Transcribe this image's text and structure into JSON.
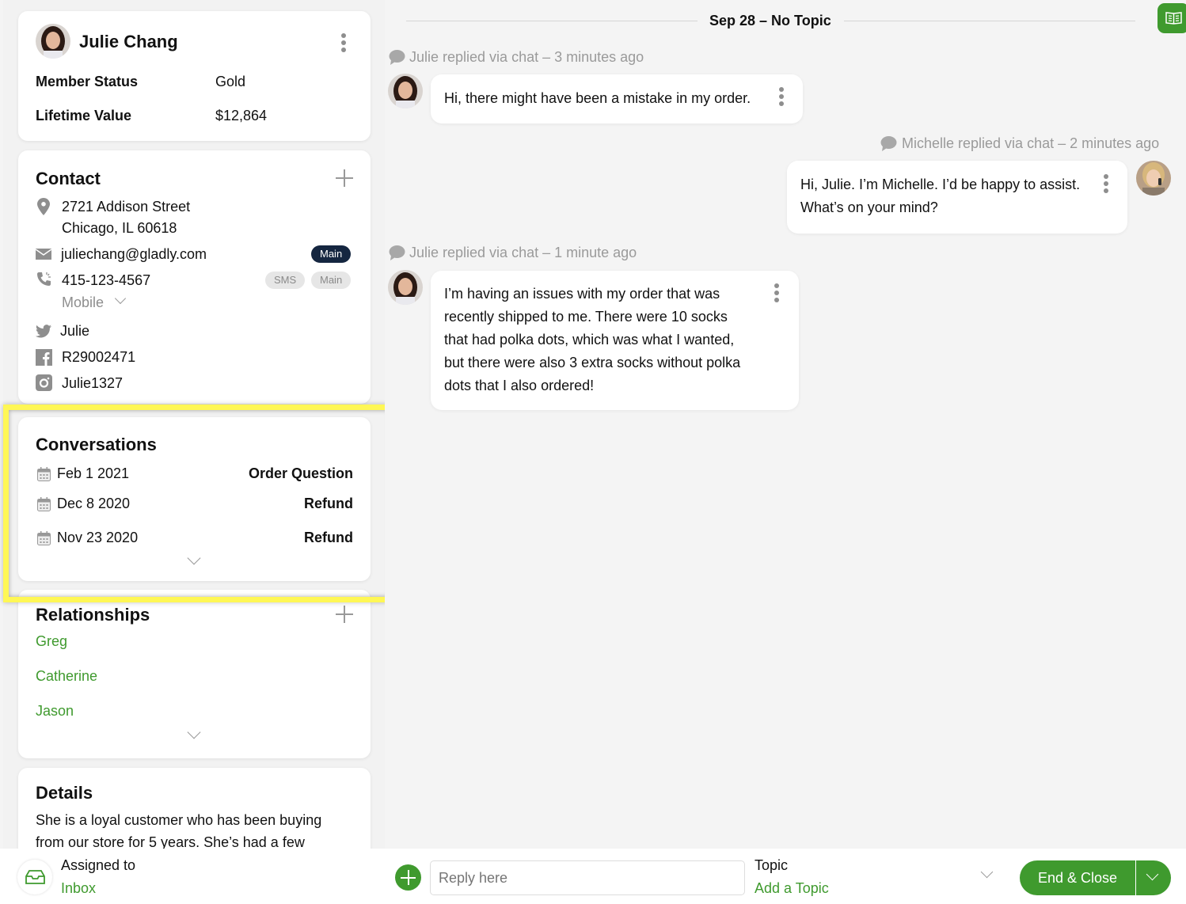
{
  "customer": {
    "name": "Julie Chang",
    "fields": [
      {
        "label": "Member Status",
        "value": "Gold"
      },
      {
        "label": "Lifetime Value",
        "value": "$12,864"
      }
    ]
  },
  "contact": {
    "title": "Contact",
    "address_line1": "2721 Addison Street",
    "address_line2": "Chicago, IL 60618",
    "email": "juliechang@gladly.com",
    "email_badge": "Main",
    "phone": "415-123-4567",
    "phone_badges": [
      "SMS",
      "Main"
    ],
    "phone_type": "Mobile",
    "twitter": "Julie",
    "facebook": "R29002471",
    "instagram": "Julie1327"
  },
  "conversations": {
    "title": "Conversations",
    "items": [
      {
        "date": "Feb 1 2021",
        "topic": "Order Question"
      },
      {
        "date": "Dec 8 2020",
        "topic": "Refund"
      },
      {
        "date": "Nov 23 2020",
        "topic": "Refund"
      }
    ]
  },
  "relationships": {
    "title": "Relationships",
    "items": [
      "Greg",
      "Catherine",
      "Jason"
    ]
  },
  "details": {
    "title": "Details",
    "line1": "She is a loyal customer who has been buying",
    "line2": "from our store for 5 years. She’s had a few"
  },
  "timeline": {
    "header": "Sep 28 – No Topic",
    "messages": [
      {
        "meta": "Julie replied via chat – 3 minutes ago",
        "text": "Hi, there might have been a mistake in my order."
      },
      {
        "meta": "Michelle replied via chat – 2 minutes ago",
        "lines": [
          "Hi, Julie. I’m Michelle. I’d be happy to assist.",
          "What’s on your mind?"
        ]
      },
      {
        "meta": "Julie replied via chat – 1 minute ago",
        "lines": [
          "I’m having an issues with my order that was",
          "recently shipped to me. There were 10 socks",
          "that had polka dots, which was what I wanted,",
          "but there were also 3 extra socks without polka",
          "dots that I also ordered!"
        ]
      }
    ]
  },
  "footer": {
    "assigned_label": "Assigned to",
    "assigned_value": "Inbox",
    "reply_placeholder": "Reply here",
    "topic_label": "Topic",
    "topic_action": "Add a Topic",
    "end_close": "End & Close"
  },
  "colors": {
    "accent_green": "#3f9a2e",
    "badge_dark": "#152640",
    "highlight": "#fff755"
  }
}
